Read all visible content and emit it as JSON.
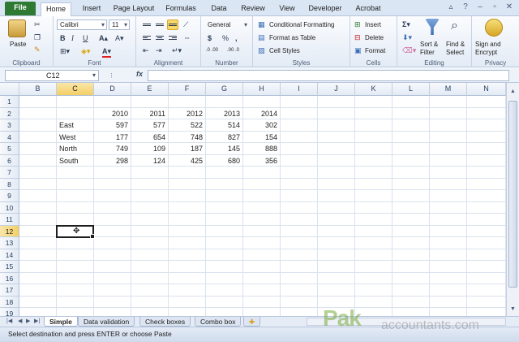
{
  "tabs": [
    "File",
    "Home",
    "Insert",
    "Page Layout",
    "Formulas",
    "Data",
    "Review",
    "View",
    "Developer",
    "Acrobat"
  ],
  "ribbon": {
    "clipboard": {
      "label": "Clipboard",
      "paste": "Paste"
    },
    "font": {
      "label": "Font",
      "name": "Calibri",
      "size": "11",
      "bold": "B",
      "italic": "I",
      "underline": "U"
    },
    "alignment": {
      "label": "Alignment"
    },
    "number": {
      "label": "Number",
      "format": "General",
      "currency": "$",
      "percent": "%",
      "comma": ",",
      "inc_decimal": ".0 .00",
      "dec_decimal": ".00 .0"
    },
    "styles": {
      "label": "Styles",
      "conditional": "Conditional Formatting",
      "format_table": "Format as Table",
      "cell_styles": "Cell Styles"
    },
    "cells": {
      "label": "Cells",
      "insert": "Insert",
      "delete": "Delete",
      "format": "Format"
    },
    "editing": {
      "label": "Editing",
      "sort": "Sort &",
      "filter": "Filter",
      "find": "Find &",
      "select": "Select"
    },
    "privacy": {
      "label": "Privacy",
      "sign": "Sign and",
      "encrypt": "Encrypt"
    }
  },
  "formula_bar": {
    "name_box": "C12",
    "fx": "fx",
    "formula": ""
  },
  "columns": [
    "B",
    "C",
    "D",
    "E",
    "F",
    "G",
    "H",
    "I",
    "J",
    "K",
    "L",
    "M",
    "N"
  ],
  "rows": [
    "1",
    "2",
    "3",
    "4",
    "5",
    "6",
    "7",
    "8",
    "9",
    "10",
    "11",
    "12",
    "13",
    "14",
    "15",
    "16",
    "17",
    "18",
    "19"
  ],
  "sheet": {
    "years": [
      "2010",
      "2011",
      "2012",
      "2013",
      "2014"
    ],
    "regions": [
      {
        "name": "East",
        "values": [
          "597",
          "577",
          "522",
          "514",
          "302"
        ]
      },
      {
        "name": "West",
        "values": [
          "177",
          "654",
          "748",
          "827",
          "154"
        ]
      },
      {
        "name": "North",
        "values": [
          "749",
          "109",
          "187",
          "145",
          "888"
        ]
      },
      {
        "name": "South",
        "values": [
          "298",
          "124",
          "425",
          "680",
          "356"
        ]
      }
    ]
  },
  "sheet_tabs": [
    "Simple",
    "Data validation",
    "Check boxes",
    "Combo box"
  ],
  "status": {
    "message": "Select destination and press ENTER or choose Paste"
  },
  "watermark": {
    "brand": "Pak",
    "site": "accountants.com"
  }
}
